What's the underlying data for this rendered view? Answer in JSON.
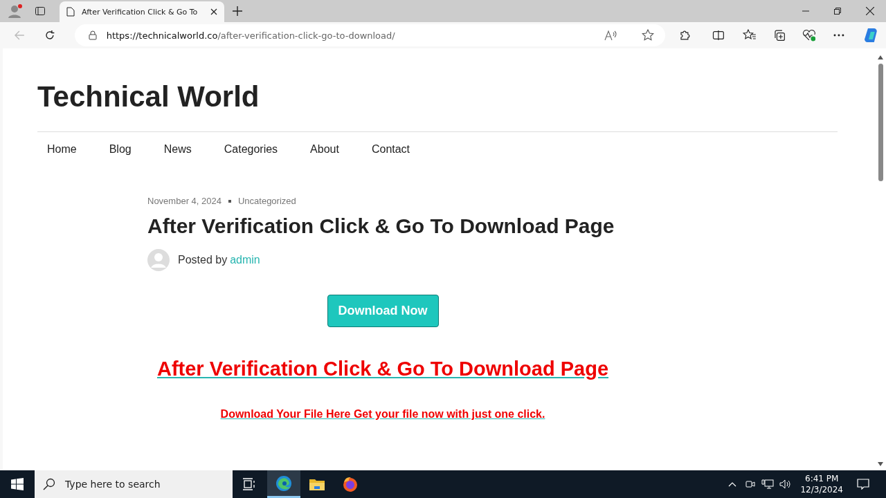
{
  "browser": {
    "tab_title": "After Verification Click & Go To",
    "url_host": "https://technicalworld.co",
    "url_path": "/after-verification-click-go-to-download/"
  },
  "site": {
    "title": "Technical World",
    "nav": [
      "Home",
      "Blog",
      "News",
      "Categories",
      "About",
      "Contact"
    ]
  },
  "post": {
    "date": "November 4, 2024",
    "category": "Uncategorized",
    "title": "After Verification Click & Go To Download Page",
    "posted_by": "Posted by",
    "author": "admin",
    "button": "Download Now",
    "big_link": "After Verification Click & Go To Download Page",
    "small_link": "Download Your File Here Get your file now with just one click."
  },
  "taskbar": {
    "search_placeholder": "Type here to search",
    "apps": [
      {
        "kind": "edge",
        "selected": true
      },
      {
        "kind": "folder",
        "selected": false
      },
      {
        "kind": "firefox",
        "selected": false
      }
    ],
    "time": "6:41 PM",
    "date": "12/3/2024"
  }
}
